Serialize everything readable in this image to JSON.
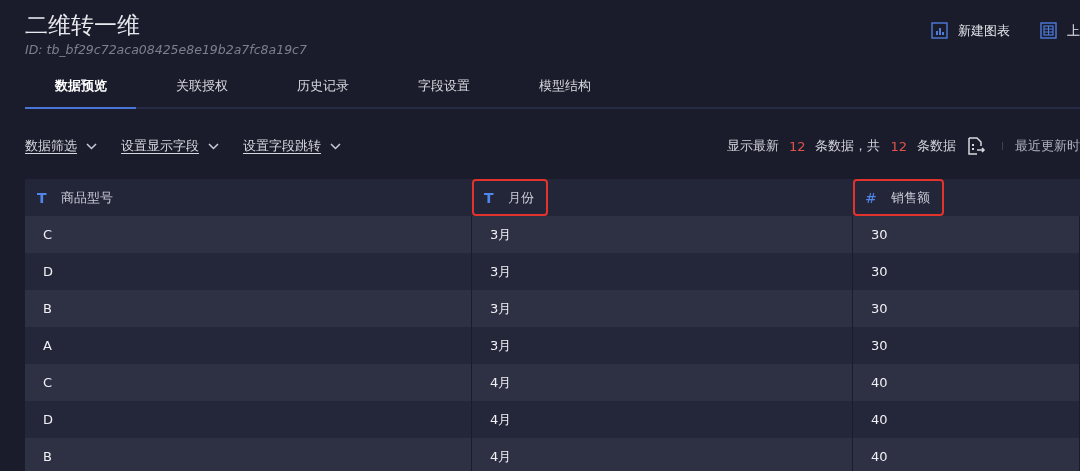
{
  "header": {
    "title": "二维转一维",
    "id_text": "ID: tb_bf29c72aca08425e8e19b2a7fc8a19c7",
    "actions": [
      {
        "label": "新建图表",
        "kind": "chart"
      },
      {
        "label": "上",
        "kind": "table"
      }
    ]
  },
  "tabs": [
    {
      "label": "数据预览",
      "selected": true
    },
    {
      "label": "关联授权",
      "selected": false
    },
    {
      "label": "历史记录",
      "selected": false
    },
    {
      "label": "字段设置",
      "selected": false
    },
    {
      "label": "模型结构",
      "selected": false
    }
  ],
  "toolbar": {
    "dropdowns": [
      "数据筛选",
      "设置显示字段",
      "设置字段跳转"
    ],
    "summary": [
      {
        "text": "显示最新",
        "kind": "label"
      },
      {
        "text": "12",
        "kind": "count"
      },
      {
        "text": "条数据，共",
        "kind": "label"
      },
      {
        "text": "12",
        "kind": "count"
      },
      {
        "text": "条数据",
        "kind": "label"
      }
    ],
    "updated": "最近更新时"
  },
  "table": {
    "columns": [
      {
        "type_icon": "T",
        "name": "商品型号",
        "highlighted": false
      },
      {
        "type_icon": "T",
        "name": "月份",
        "highlighted": true
      },
      {
        "type_icon": "#",
        "name": "销售额",
        "highlighted": true
      }
    ],
    "rows": [
      [
        "C",
        "3月",
        "30"
      ],
      [
        "D",
        "3月",
        "30"
      ],
      [
        "B",
        "3月",
        "30"
      ],
      [
        "A",
        "3月",
        "30"
      ],
      [
        "C",
        "4月",
        "40"
      ],
      [
        "D",
        "4月",
        "40"
      ],
      [
        "B",
        "4月",
        "40"
      ]
    ]
  }
}
